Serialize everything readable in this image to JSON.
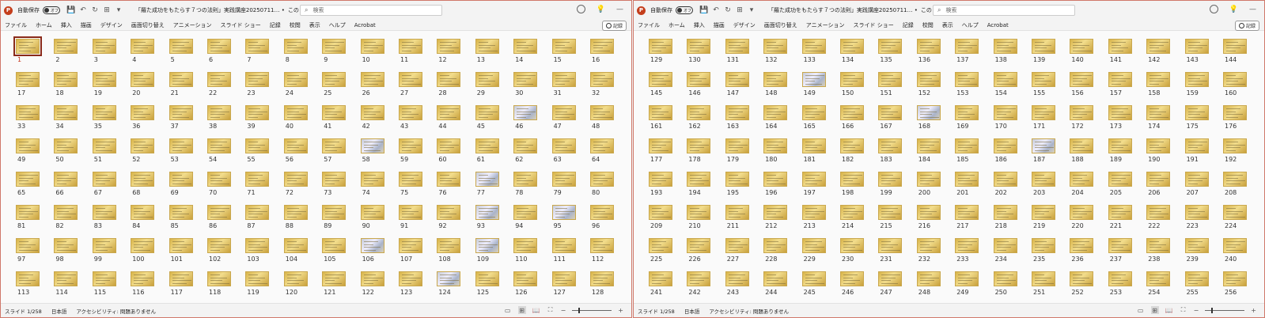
{
  "colors": {
    "accent": "#c43e1c",
    "selection": "#8a2a1a",
    "thumb": "#e3c56a"
  },
  "windows": [
    {
      "title_bar": {
        "app_icon": "P",
        "autosave_label": "自動保存",
        "autosave_state": "オフ",
        "document_title": "「羅た成功をもたらす７つの法則」実践講座20250711… •",
        "saved_state": "この PC に保存済み ∨",
        "search_placeholder": "検索",
        "icons": [
          "save-icon",
          "undo-icon",
          "redo-icon",
          "present-icon",
          "customize-icon",
          "account-icon",
          "lightbulb-icon",
          "minimize-icon"
        ]
      },
      "ribbon": {
        "tabs": [
          "ファイル",
          "ホーム",
          "挿入",
          "描画",
          "デザイン",
          "画面切り替え",
          "アニメーション",
          "スライド ショー",
          "記録",
          "校閲",
          "表示",
          "ヘルプ",
          "Acrobat"
        ],
        "record_label": "記録"
      },
      "start": 1,
      "selected": 1,
      "image_slides": [
        46,
        58,
        77,
        93,
        95,
        106,
        109,
        124
      ],
      "status": {
        "slide": "スライド 1/258",
        "language": "日本語",
        "accessibility": "アクセシビリティ: 問題ありません"
      }
    },
    {
      "title_bar": {
        "app_icon": "P",
        "autosave_label": "自動保存",
        "autosave_state": "オフ",
        "document_title": "「羅た成功をもたらす７つの法則」実践講座20250711… •",
        "saved_state": "この PC に保存済み ∨",
        "search_placeholder": "検索",
        "icons": [
          "save-icon",
          "undo-icon",
          "redo-icon",
          "present-icon",
          "customize-icon",
          "account-icon",
          "lightbulb-icon",
          "minimize-icon"
        ]
      },
      "ribbon": {
        "tabs": [
          "ファイル",
          "ホーム",
          "挿入",
          "描画",
          "デザイン",
          "画面切り替え",
          "アニメーション",
          "スライド ショー",
          "記録",
          "校閲",
          "表示",
          "ヘルプ",
          "Acrobat"
        ],
        "record_label": "記録"
      },
      "start": 129,
      "selected": null,
      "image_slides": [
        149,
        168,
        187
      ],
      "status": {
        "slide": "スライド 1/258",
        "language": "日本語",
        "accessibility": "アクセシビリティ: 問題ありません"
      }
    }
  ]
}
